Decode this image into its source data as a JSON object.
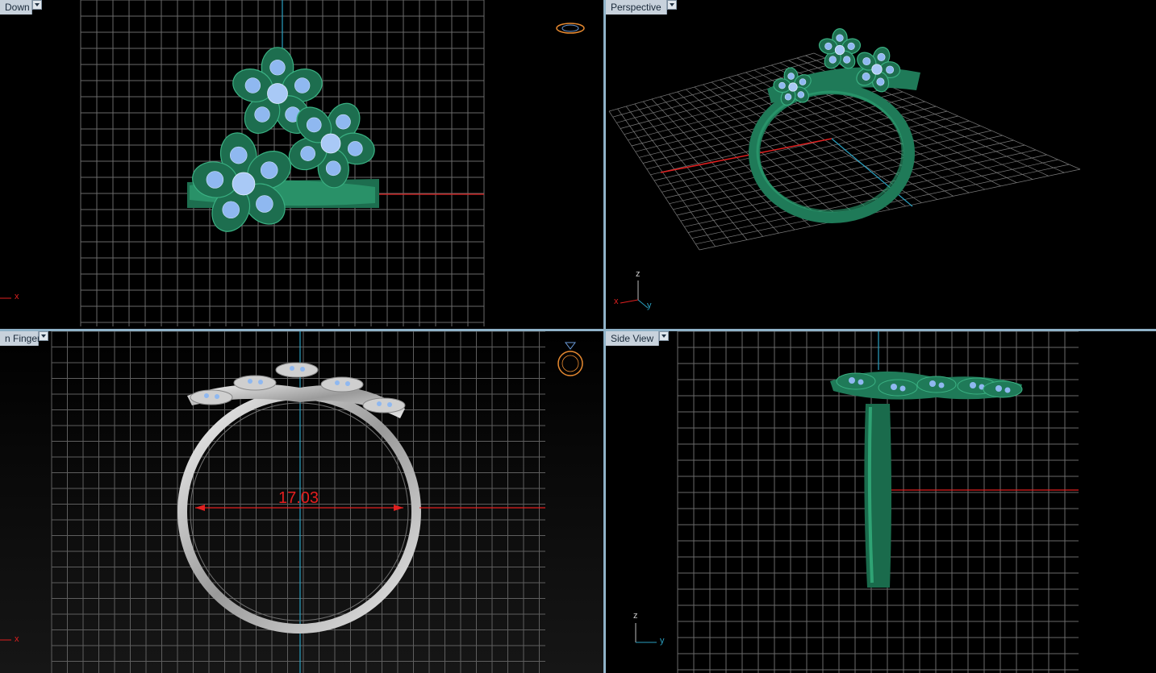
{
  "viewports": {
    "top_left": {
      "name": "Down",
      "axis_x": "x"
    },
    "top_right": {
      "name": "Perspective",
      "axis_x": "x",
      "axis_y": "y",
      "axis_z": "z"
    },
    "bottom_left": {
      "name": "n Finger",
      "axis_x": "x",
      "dimension": "17.03"
    },
    "bottom_right": {
      "name": "Side View",
      "axis_z": "z",
      "axis_y": "y"
    }
  },
  "colors": {
    "grid": "#6a6a6a",
    "background": "#000000",
    "x_axis": "#e02020",
    "y_axis": "#2aa0c0",
    "ring_green": "#1f7a58",
    "ring_silver": "#d8d8d8",
    "gem": "#8fb8f0",
    "viewport_border": "#8fb2c8",
    "tab_bg": "#c8d2dc"
  },
  "icons": [
    "ring-orientation-icon",
    "ring-front-icon",
    "view-dropdown-icon"
  ]
}
